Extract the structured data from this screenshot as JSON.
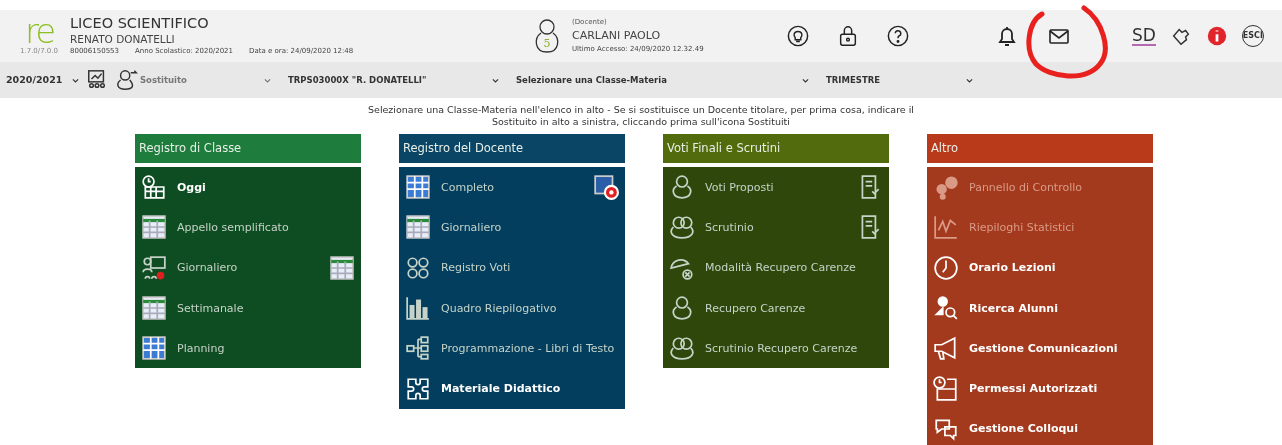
{
  "header": {
    "logo_text": "re",
    "version": "1.7.0/7.0.0",
    "school": "LICEO SCIENTIFICO",
    "school_name": "RENATO DONATELLI",
    "code": "80006150553",
    "school_year": "Anno Scolastico: 2020/2021",
    "datetime": "Data e ora: 24/09/2020 12:48",
    "user": {
      "badge": "5",
      "role": "(Docente)",
      "name": "CARLANI PAOLO",
      "last_access": "Ultimo Accesso: 24/09/2020 12.32.49"
    },
    "sd_logo": "SD",
    "exit": "ESCI"
  },
  "annotation": {
    "circled": true
  },
  "toolbar": {
    "year": "2020/2021",
    "substitute": "Sostituito",
    "school": "TRPS03000X \"R. DONATELLI\"",
    "class_subject": "Selezionare una Classe-Materia",
    "period": "TRIMESTRE"
  },
  "notice": "Selezionare una Classe-Materia nell'elenco in alto - Se si sostituisce un Docente titolare, per prima cosa, indicare il Sostituito in alto a sinistra, cliccando prima sull'icona Sostituiti",
  "panels": [
    {
      "title": "Registro di Classe",
      "color": "#1e7d3c",
      "items": [
        {
          "label": "Oggi",
          "bold": true,
          "disabled": false,
          "extra_icon": false
        },
        {
          "label": "Appello semplificato",
          "bold": false,
          "disabled": false,
          "extra_icon": false
        },
        {
          "label": "Giornaliero",
          "bold": false,
          "disabled": false,
          "extra_icon": true
        },
        {
          "label": "Settimanale",
          "bold": false,
          "disabled": false,
          "extra_icon": false
        },
        {
          "label": "Planning",
          "bold": false,
          "disabled": false,
          "extra_icon": false
        }
      ]
    },
    {
      "title": "Registro del Docente",
      "color": "#0b4566",
      "items": [
        {
          "label": "Completo",
          "bold": false,
          "disabled": false,
          "extra_icon": true
        },
        {
          "label": "Giornaliero",
          "bold": false,
          "disabled": false,
          "extra_icon": false
        },
        {
          "label": "Registro Voti",
          "bold": false,
          "disabled": false,
          "extra_icon": false
        },
        {
          "label": "Quadro Riepilogativo",
          "bold": false,
          "disabled": false,
          "extra_icon": false
        },
        {
          "label": "Programmazione - Libri di Testo",
          "bold": false,
          "disabled": false,
          "extra_icon": false
        },
        {
          "label": "Materiale Didattico",
          "bold": true,
          "disabled": false,
          "extra_icon": false
        }
      ]
    },
    {
      "title": "Voti Finali e Scrutini",
      "color": "#526b0c",
      "items": [
        {
          "label": "Voti Proposti",
          "bold": false,
          "disabled": false,
          "extra_icon": true
        },
        {
          "label": "Scrutinio",
          "bold": false,
          "disabled": false,
          "extra_icon": true
        },
        {
          "label": "Modalità Recupero Carenze",
          "bold": false,
          "disabled": false,
          "extra_icon": false
        },
        {
          "label": "Recupero Carenze",
          "bold": false,
          "disabled": false,
          "extra_icon": false
        },
        {
          "label": "Scrutinio Recupero Carenze",
          "bold": false,
          "disabled": false,
          "extra_icon": false
        }
      ]
    },
    {
      "title": "Altro",
      "color": "#b83a1b",
      "items": [
        {
          "label": "Pannello di Controllo",
          "bold": false,
          "disabled": true,
          "extra_icon": false
        },
        {
          "label": "Riepiloghi Statistici",
          "bold": false,
          "disabled": true,
          "extra_icon": false
        },
        {
          "label": "Orario Lezioni",
          "bold": true,
          "disabled": false,
          "extra_icon": false
        },
        {
          "label": "Ricerca Alunni",
          "bold": true,
          "disabled": false,
          "extra_icon": false
        },
        {
          "label": "Gestione Comunicazioni",
          "bold": true,
          "disabled": false,
          "extra_icon": false
        },
        {
          "label": "Permessi Autorizzati",
          "bold": true,
          "disabled": false,
          "extra_icon": false
        },
        {
          "label": "Gestione Colloqui",
          "bold": true,
          "disabled": false,
          "extra_icon": false
        }
      ]
    }
  ]
}
